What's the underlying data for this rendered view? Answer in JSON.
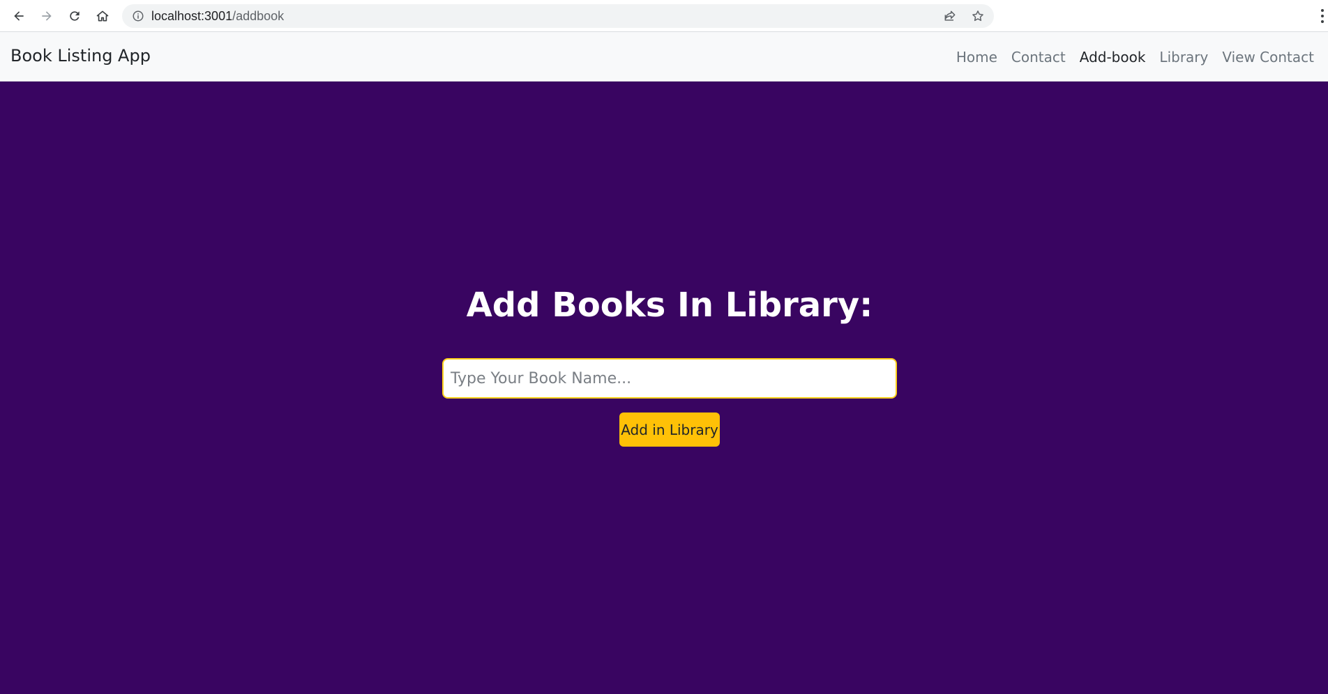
{
  "browser": {
    "url_host": "localhost:3001",
    "url_path": "/addbook"
  },
  "navbar": {
    "brand": "Book Listing App",
    "links": [
      {
        "label": "Home",
        "active": false
      },
      {
        "label": "Contact",
        "active": false
      },
      {
        "label": "Add-book",
        "active": true
      },
      {
        "label": "Library",
        "active": false
      },
      {
        "label": "View Contact",
        "active": false
      }
    ]
  },
  "main": {
    "title": "Add Books In Library:",
    "input_placeholder": "Type Your Book Name...",
    "input_value": "",
    "button_label": "Add in Library"
  },
  "colors": {
    "background": "#390561",
    "accent": "#ffc107",
    "input_border": "#ffd11a"
  },
  "icons": {
    "back": "arrow-left-icon",
    "forward": "arrow-right-icon",
    "reload": "reload-icon",
    "home": "home-icon",
    "site_info": "info-icon",
    "share": "share-icon",
    "bookmark": "star-icon",
    "menu": "kebab-menu-icon"
  }
}
